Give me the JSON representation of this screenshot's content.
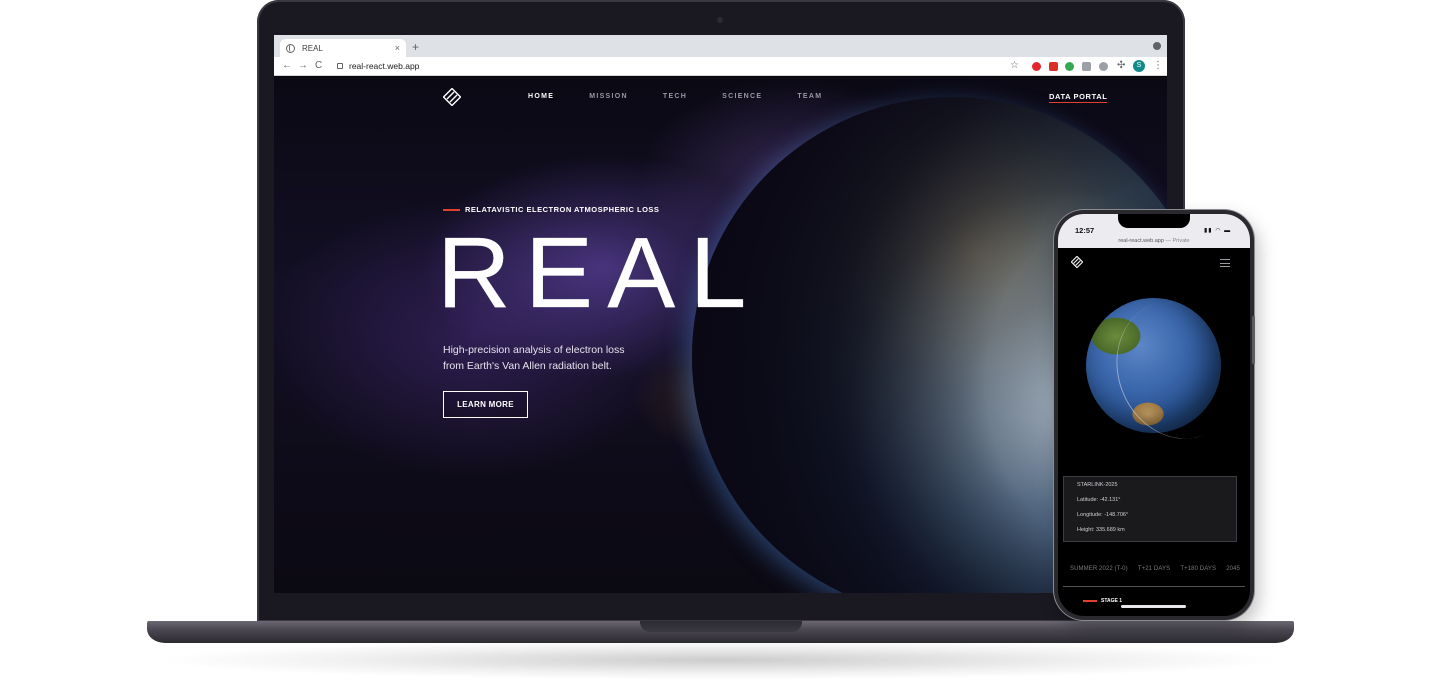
{
  "browser": {
    "tab_title": "REAL",
    "tab_close": "×",
    "new_tab": "+",
    "back": "←",
    "forward": "→",
    "reload": "C",
    "url": "real-react.web.app",
    "bookmark": "☆",
    "puzzle": "✣",
    "profile_initial": "S",
    "menu": "⋮"
  },
  "site": {
    "nav": {
      "items": [
        {
          "label": "HOME",
          "active": true
        },
        {
          "label": "MISSION",
          "active": false
        },
        {
          "label": "TECH",
          "active": false
        },
        {
          "label": "SCIENCE",
          "active": false
        },
        {
          "label": "TEAM",
          "active": false
        }
      ],
      "cta": "DATA PORTAL"
    },
    "hero": {
      "eyebrow": "RELATAVISTIC ELECTRON ATMOSPHERIC LOSS",
      "title": "REAL",
      "description_line1": "High-precision analysis of electron loss",
      "description_line2": "from Earth's Van Allen radiation belt.",
      "button": "LEARN MORE"
    }
  },
  "phone": {
    "time": "12:57",
    "status_icons": "▮▮ ◠ ▬",
    "address": "real-react.web.app",
    "private": "— Private",
    "satellite": {
      "name": "STARLINK-2025",
      "latitude": "Latitude: -42.131°",
      "longitude": "Longitude: -148.706°",
      "height": "Height: 335.689 km"
    },
    "timeline": [
      "SUMMER 2022 (T-0)",
      "T+21 DAYS",
      "T+180 DAYS",
      "2045"
    ],
    "stage": "STAGE 1"
  },
  "colors": {
    "accent": "#e0402f",
    "laptop_body": "#1a1820",
    "ocean": "#3c68ad"
  },
  "icons": {
    "site_logo": "diagonal-stripes-diamond-icon",
    "tab_favicon": "globe-icon",
    "lock": "lock-icon",
    "hamburger": "hamburger-menu-icon"
  }
}
